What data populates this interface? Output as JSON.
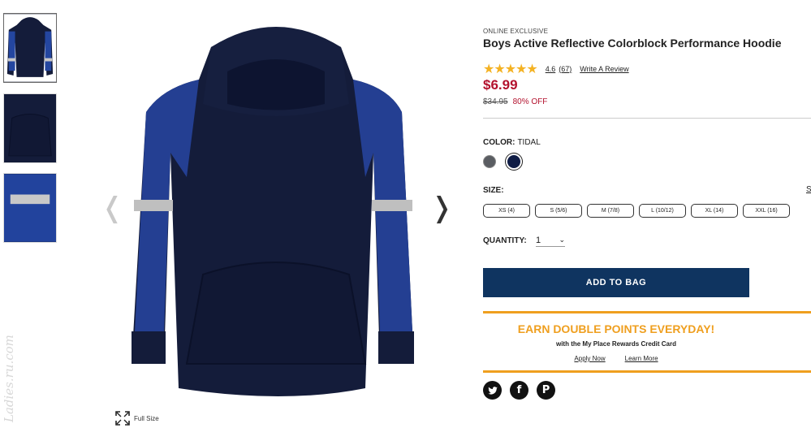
{
  "gallery": {
    "thumbnails": [
      {
        "name": "front-view"
      },
      {
        "name": "pocket-detail"
      },
      {
        "name": "sleeve-reflective-detail"
      }
    ],
    "full_size_label": "Full Size",
    "watermark": "Ladies.ru.com"
  },
  "product": {
    "badge": "ONLINE EXCLUSIVE",
    "title": "Boys Active Reflective Colorblock Performance Hoodie",
    "rating": {
      "stars": 4.6,
      "score_text": "4.6",
      "count_text": "(67)",
      "write_review": "Write A Review"
    },
    "price": "$6.99",
    "original_price": "$34.95",
    "discount": "80% OFF"
  },
  "color": {
    "label": "COLOR:",
    "selected": "TIDAL",
    "swatches": [
      {
        "name": "gray",
        "hex": "#5a5d62"
      },
      {
        "name": "tidal",
        "hex": "#0f1c45"
      }
    ]
  },
  "size": {
    "label": "SIZE:",
    "chart_link": "S",
    "options": [
      "XS (4)",
      "S (5/6)",
      "M (7/8)",
      "L (10/12)",
      "XL (14)",
      "XXL (16)"
    ]
  },
  "quantity": {
    "label": "QUANTITY:",
    "value": "1"
  },
  "add_to_bag": "ADD TO BAG",
  "promo": {
    "headline": "EARN DOUBLE POINTS EVERYDAY!",
    "subline": "with the My Place Rewards Credit Card",
    "apply": "Apply Now",
    "learn": "Learn More",
    "accent": "#ef9f1f"
  },
  "social": [
    {
      "name": "twitter-icon"
    },
    {
      "name": "facebook-icon"
    },
    {
      "name": "pinterest-icon"
    }
  ],
  "colors": {
    "brand_blue": "#0f3460",
    "price_red": "#b3122e",
    "star": "#f4b223"
  }
}
